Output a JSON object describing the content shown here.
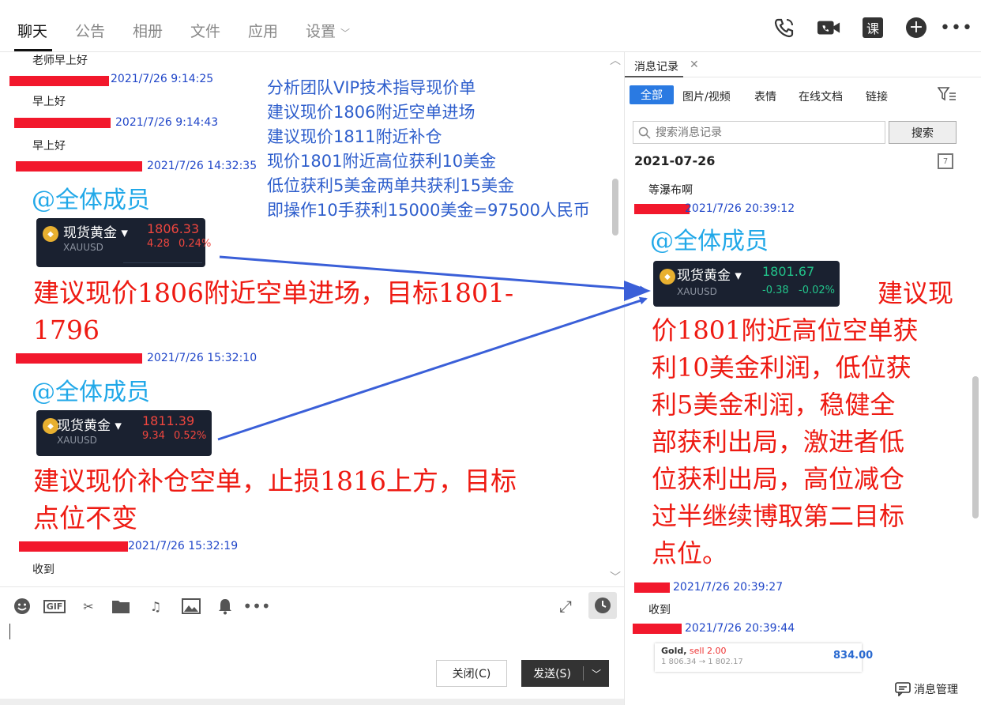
{
  "tabs": [
    "聊天",
    "公告",
    "相册",
    "文件",
    "应用",
    "设置"
  ],
  "chat": {
    "msg0": "老师早上好",
    "h1": "2021/7/26 9:14:25",
    "msg1": "早上好",
    "h2": "2021/7/26 9:14:43",
    "msg2": "早上好",
    "h3": "2021/7/26 14:32:35",
    "mention": "@全体成员",
    "card1": {
      "name": "现货黄金",
      "symbol": "XAUUSD",
      "price": "1806.33",
      "chg": "4.28",
      "pct": "0.24%"
    },
    "red1a": "建议现价1806附近空单进场，目标1801-",
    "red1b": "1796",
    "h4": "2021/7/26 15:32:10",
    "card2": {
      "name": "现货黄金",
      "symbol": "XAUUSD",
      "price": "1811.39",
      "chg": "9.34",
      "pct": "0.52%"
    },
    "red2a": "建议现价补仓空单，止损1816上方，目标",
    "red2b": "点位不变",
    "h5": "2021/7/26 15:32:19",
    "msg5": "收到",
    "blue": [
      "分析团队VIP技术指导现价单",
      "建议现价1806附近空单进场",
      "建议现价1811附近补仓",
      "现价1801附近高位获利10美金",
      "低位获利5美金两单共获利15美金",
      "即操作10手获利15000美金=97500人民币"
    ]
  },
  "input": {
    "close": "关闭(C)",
    "send": "发送(S)"
  },
  "right": {
    "tab": "消息记录",
    "filters": [
      "全部",
      "图片/视频",
      "表情",
      "在线文档",
      "链接"
    ],
    "search_placeholder": "搜索消息记录",
    "search_btn": "搜索",
    "date": "2021-07-26",
    "m0": "等瀑布啊",
    "h1": "2021/7/26 20:39:12",
    "mention": "@全体成员",
    "card": {
      "name": "现货黄金",
      "symbol": "XAUUSD",
      "price": "1801.67",
      "chg": "-0.38",
      "pct": "-0.02%"
    },
    "red": [
      "建议现",
      "价1801附近高位空单获",
      "利10美金利润，低位获",
      "利5美金利润，稳健全",
      "部获利出局，激进者低",
      "位获利出局，高位减仓",
      "过半继续博取第二目标",
      "点位。"
    ],
    "h2": "2021/7/26 20:39:27",
    "m2": "收到",
    "h3": "2021/7/26 20:39:44",
    "sell": {
      "asset": "Gold,",
      "side": "sell 2.00",
      "range": "1 806.34 → 1 802.17",
      "value": "834.00"
    },
    "manage": "消息管理"
  },
  "colors": {
    "accent": "#2a7ae2",
    "annotation_red": "#ee1a12",
    "annotation_blue": "#2e5ecc",
    "mention": "#21a8e8",
    "up_red": "#f0463e",
    "down_green": "#22c38a"
  }
}
